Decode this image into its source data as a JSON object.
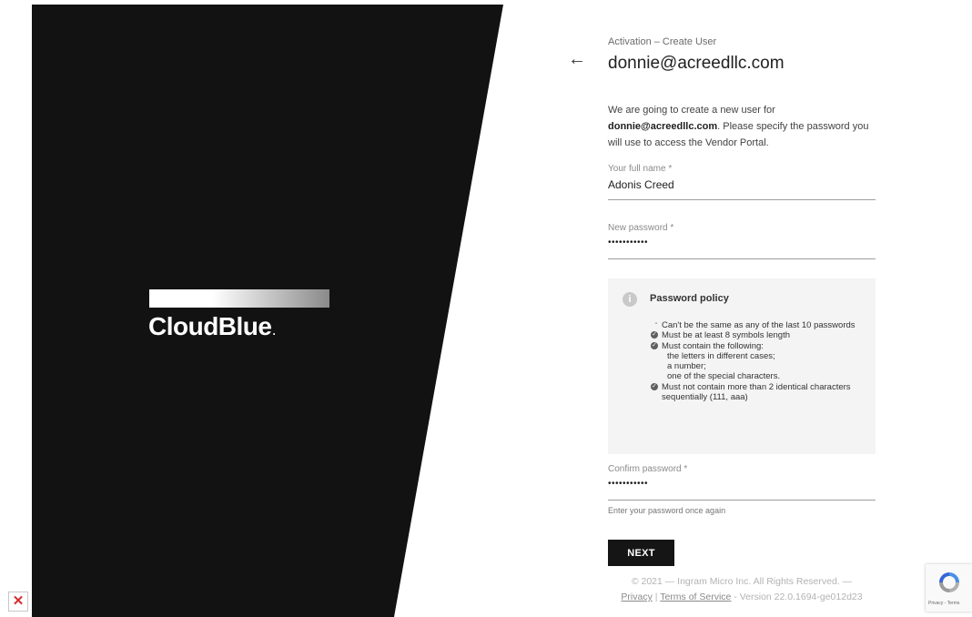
{
  "brand": {
    "logo_text": "CloudBlue",
    "logo_dot": ".",
    "panel_color": "#121212"
  },
  "header": {
    "subtitle": "Activation – Create User",
    "title": "donnie@acreedllc.com"
  },
  "description": {
    "intro": "We are going to create a new user for ",
    "email": "donnie@acreedllc.com",
    "rest": ". Please specify the password you will use to access the Vendor Portal."
  },
  "form": {
    "full_name": {
      "label": "Your full name *",
      "value": "Adonis Creed"
    },
    "new_password": {
      "label": "New password *",
      "value": "•••••••••••"
    },
    "confirm_password": {
      "label": "Confirm password *",
      "value": "•••••••••••",
      "hint": "Enter your password once again"
    }
  },
  "policy": {
    "title": "Password policy",
    "items": [
      {
        "status": "pending",
        "text": "Can't be the same as any of the last 10 passwords"
      },
      {
        "status": "met",
        "text": "Must be at least 8 symbols length"
      },
      {
        "status": "met",
        "text": "Must contain the following:"
      },
      {
        "sub": "the letters in different cases;"
      },
      {
        "sub": "a number;"
      },
      {
        "sub": "one of the special characters."
      },
      {
        "status": "met",
        "text": "Must not contain more than 2 identical characters sequentially (111, aaa)"
      }
    ]
  },
  "actions": {
    "next_label": "NEXT"
  },
  "footer": {
    "copyright": "© 2021 — Ingram Micro Inc. All Rights Reserved. —",
    "privacy": "Privacy",
    "separator": " | ",
    "terms": "Terms of Service",
    "version": " - Version 22.0.1694-ge012d23"
  },
  "recaptcha": {
    "text": "Privacy - Terms"
  },
  "icons": {
    "back": "arrow-left-icon",
    "info": "info-icon",
    "check": "check-circle-icon",
    "broken_image": "broken-image-icon",
    "recaptcha": "recaptcha-icon"
  }
}
